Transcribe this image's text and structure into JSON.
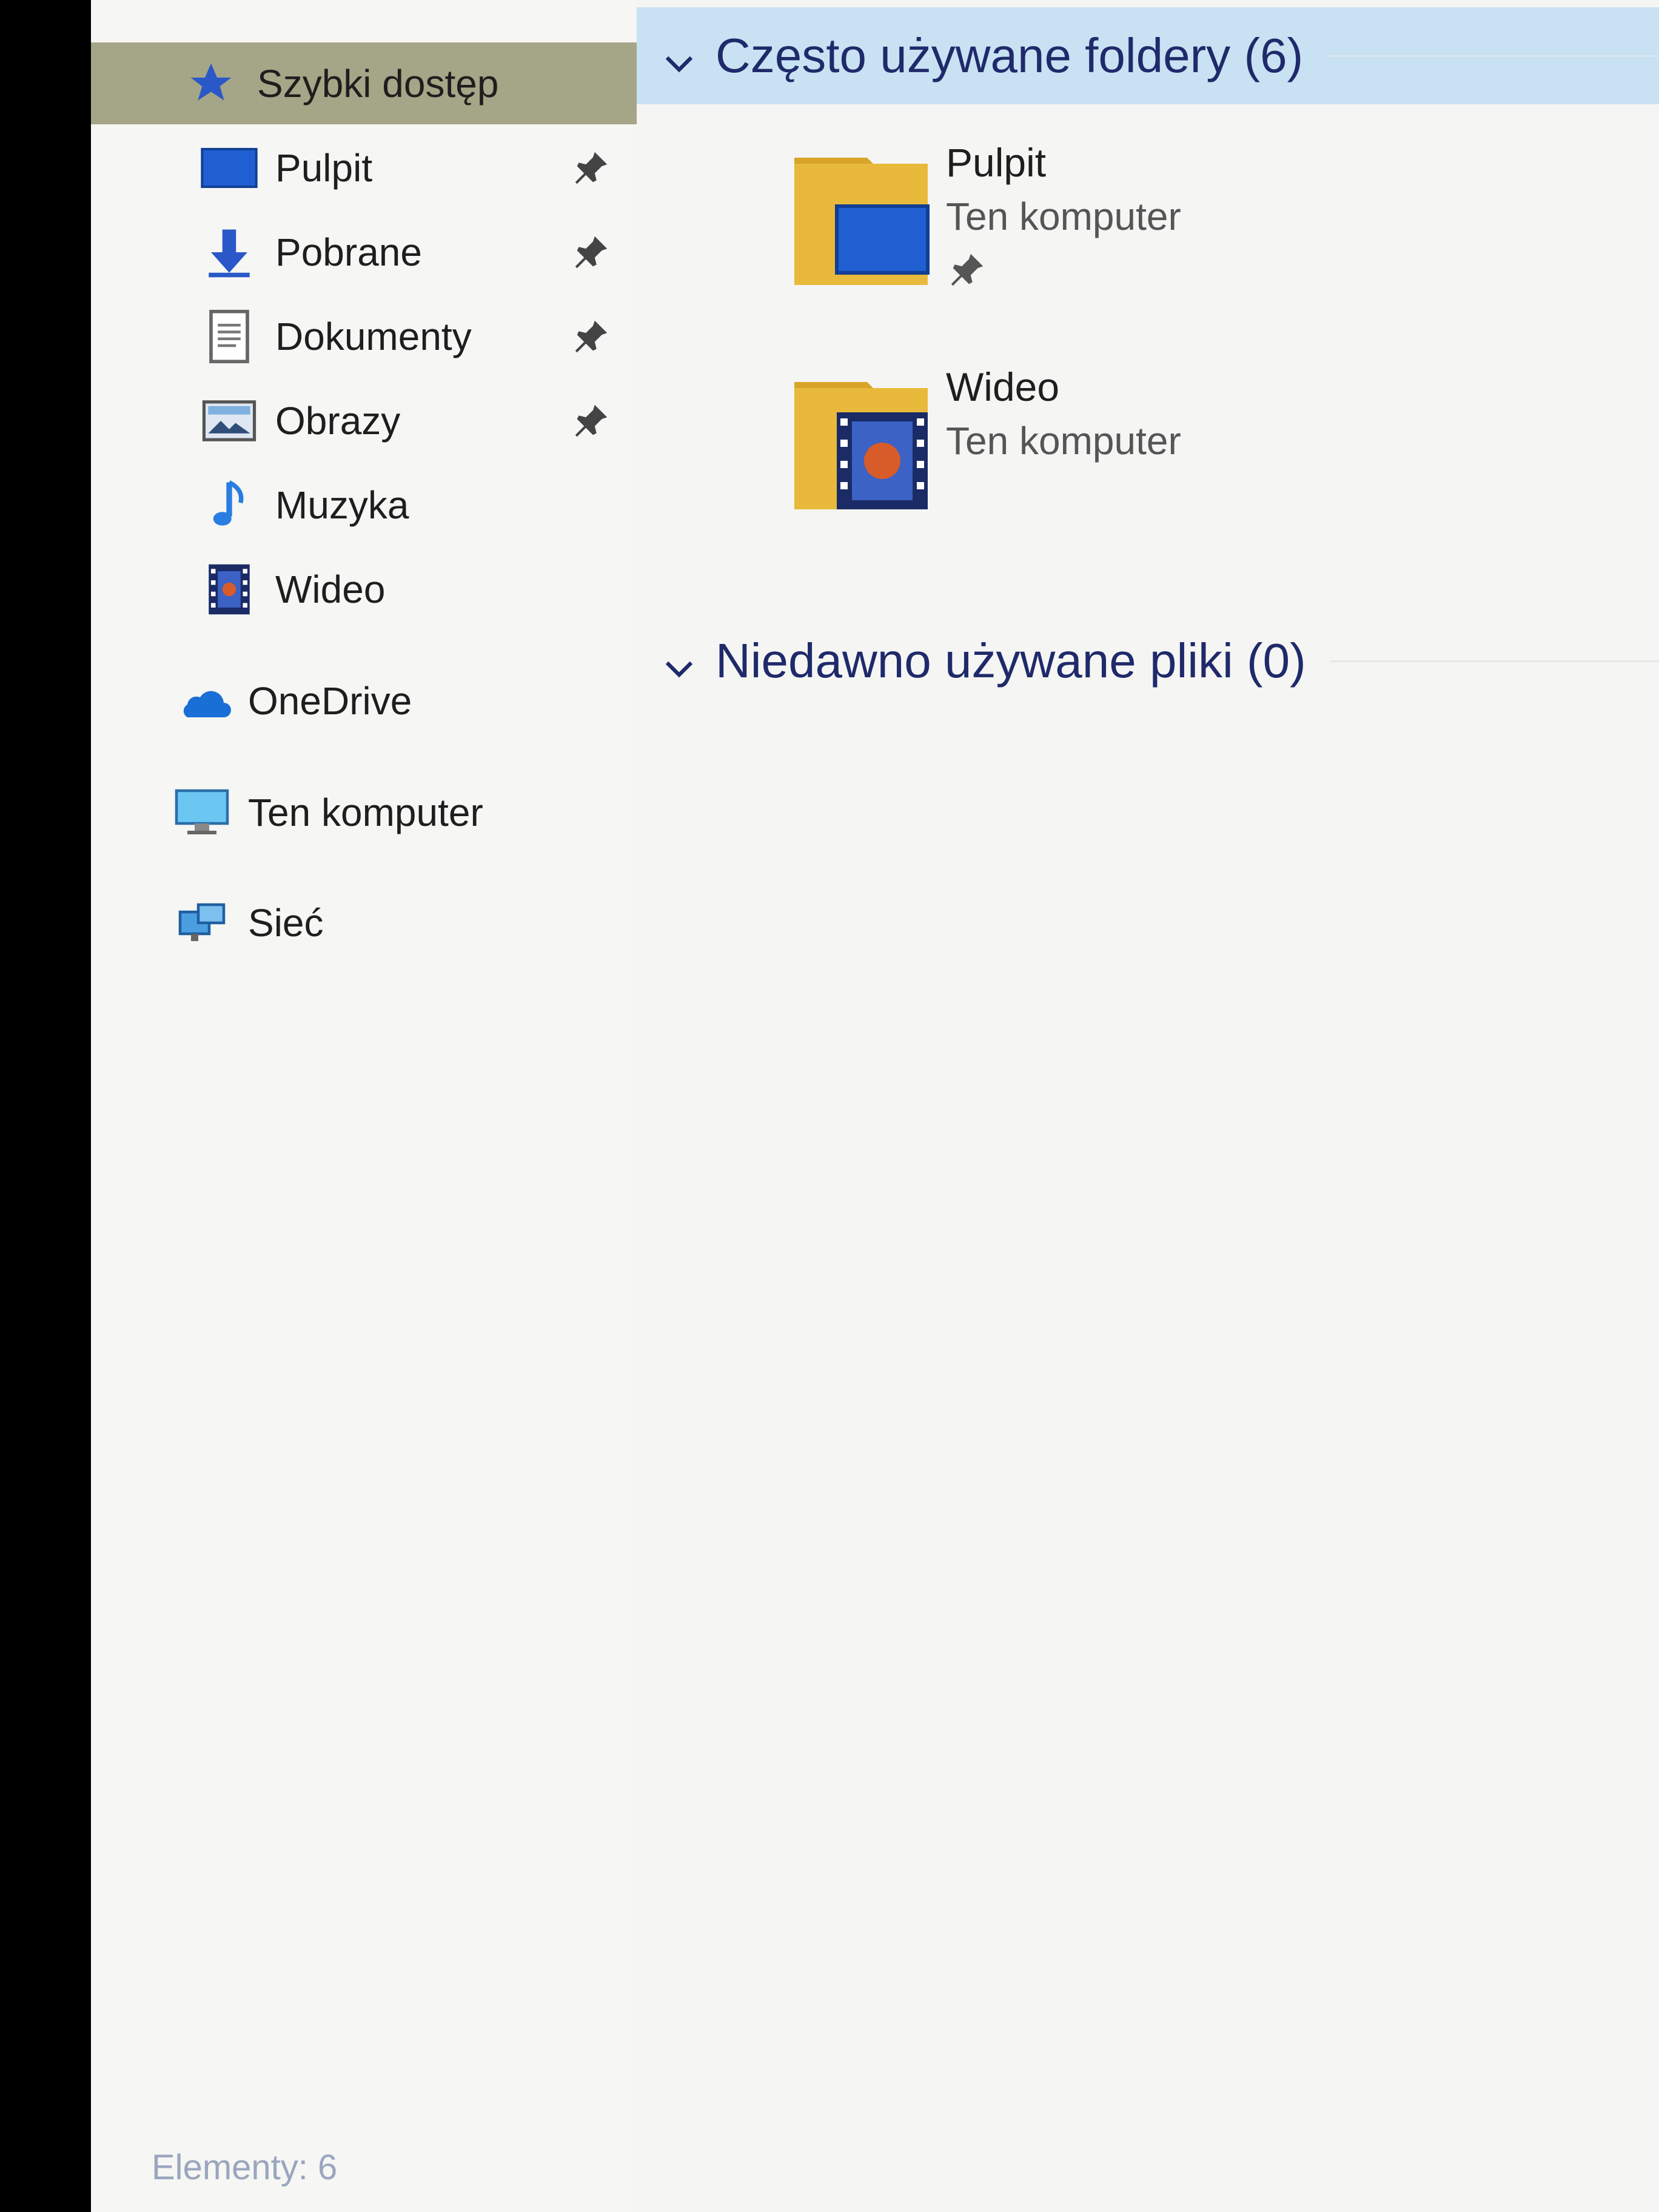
{
  "nav": {
    "quick_access": "Szybki dostęp",
    "items": [
      {
        "label": "Pulpit",
        "pinned": true,
        "icon": "desktop-icon"
      },
      {
        "label": "Pobrane",
        "pinned": true,
        "icon": "download-arrow-icon"
      },
      {
        "label": "Dokumenty",
        "pinned": true,
        "icon": "document-icon"
      },
      {
        "label": "Obrazy",
        "pinned": true,
        "icon": "pictures-icon"
      },
      {
        "label": "Muzyka",
        "pinned": false,
        "icon": "music-note-icon"
      },
      {
        "label": "Wideo",
        "pinned": false,
        "icon": "video-film-icon"
      }
    ],
    "onedrive": "OneDrive",
    "this_pc": "Ten komputer",
    "network": "Sieć"
  },
  "content": {
    "frequent_header": "Często używane foldery (6)",
    "recent_header": "Niedawno używane pliki (0)",
    "folders": [
      {
        "name": "Pulpit",
        "location": "Ten komputer",
        "pinned": true
      },
      {
        "name": "Wideo",
        "location": "Ten komputer",
        "pinned": false
      }
    ]
  },
  "status_bar": {
    "text": "Elementy: 6"
  },
  "colors": {
    "selected_nav": "#a5a587",
    "selected_header": "#c8e2f3",
    "header_text": "#1f2a6b",
    "folder_yellow": "#e8b93b",
    "accent_blue": "#1f5fd1"
  }
}
